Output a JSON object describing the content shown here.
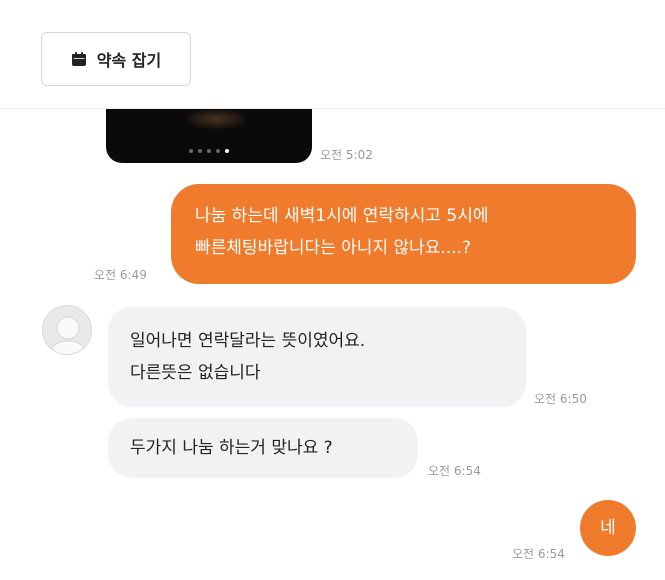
{
  "header": {
    "appointment_button": {
      "label": "약속 잡기",
      "icon": "calendar-icon"
    }
  },
  "chat": {
    "photo": {
      "time": "오전 5:02",
      "page_count": 5,
      "active_page": 5
    },
    "messages": [
      {
        "side": "out",
        "lines": [
          "나눔 하는데 새벽1시에 연락하시고 5시에",
          "빠른체팅바랍니다는 아니지 않나요....?"
        ],
        "time": "오전 6:49"
      },
      {
        "side": "in",
        "lines": [
          "일어나면 연락달라는 뜻이였어요.",
          "다른뜻은 없습니다"
        ],
        "time": "오전 6:50"
      },
      {
        "side": "in",
        "lines": [
          "두가지 나눔 하는거 맞나요 ?"
        ],
        "time": "오전 6:54"
      },
      {
        "side": "out",
        "lines": [
          "네"
        ],
        "time": "오전 6:54"
      }
    ]
  },
  "colors": {
    "accent": "#f07b2c",
    "incoming_bubble": "#f2f2f4",
    "timestamp": "#9a9a9a"
  }
}
